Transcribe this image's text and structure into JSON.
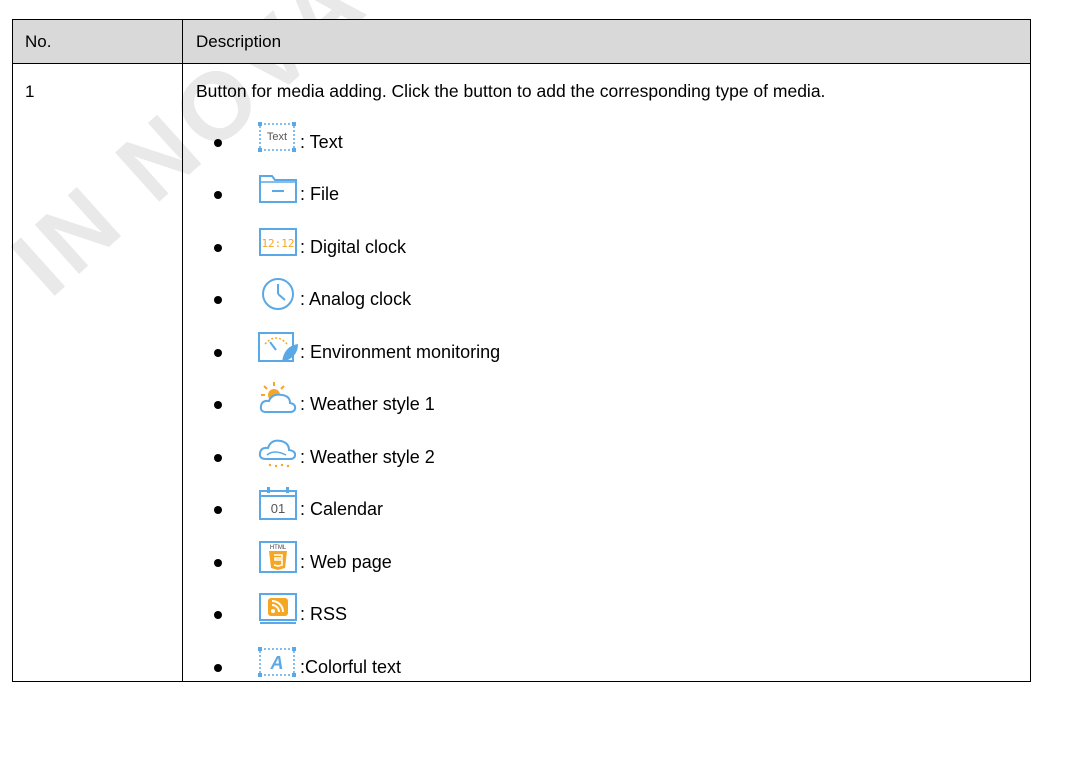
{
  "watermark": "IN NOVAS",
  "table": {
    "headers": {
      "no": "No.",
      "description": "Description"
    },
    "row": {
      "no": "1",
      "description": "Button for media adding. Click the button to add the corresponding type of media.",
      "items": [
        {
          "icon": "text-icon",
          "label": ": Text"
        },
        {
          "icon": "file-icon",
          "label": ": File"
        },
        {
          "icon": "digital-clock-icon",
          "label": ": Digital clock"
        },
        {
          "icon": "analog-clock-icon",
          "label": ": Analog clock"
        },
        {
          "icon": "environment-monitoring-icon",
          "label": ": Environment monitoring"
        },
        {
          "icon": "weather-style-1-icon",
          "label": ": Weather style 1"
        },
        {
          "icon": "weather-style-2-icon",
          "label": ": Weather style 2"
        },
        {
          "icon": "calendar-icon",
          "label": ": Calendar"
        },
        {
          "icon": "web-page-icon",
          "label": ": Web page"
        },
        {
          "icon": "rss-icon",
          "label": ": RSS"
        },
        {
          "icon": "colorful-text-icon",
          "label": ":Colorful text"
        }
      ]
    }
  },
  "icon_glyphs": {
    "text": "Text",
    "digital_clock": "12:12",
    "calendar_day": "01",
    "html": "HTML",
    "colorful": "A"
  },
  "colors": {
    "icon_blue": "#5aa9e6",
    "icon_orange": "#f5a623",
    "header_bg": "#d9d9d9",
    "watermark": "#e8e8e8"
  }
}
